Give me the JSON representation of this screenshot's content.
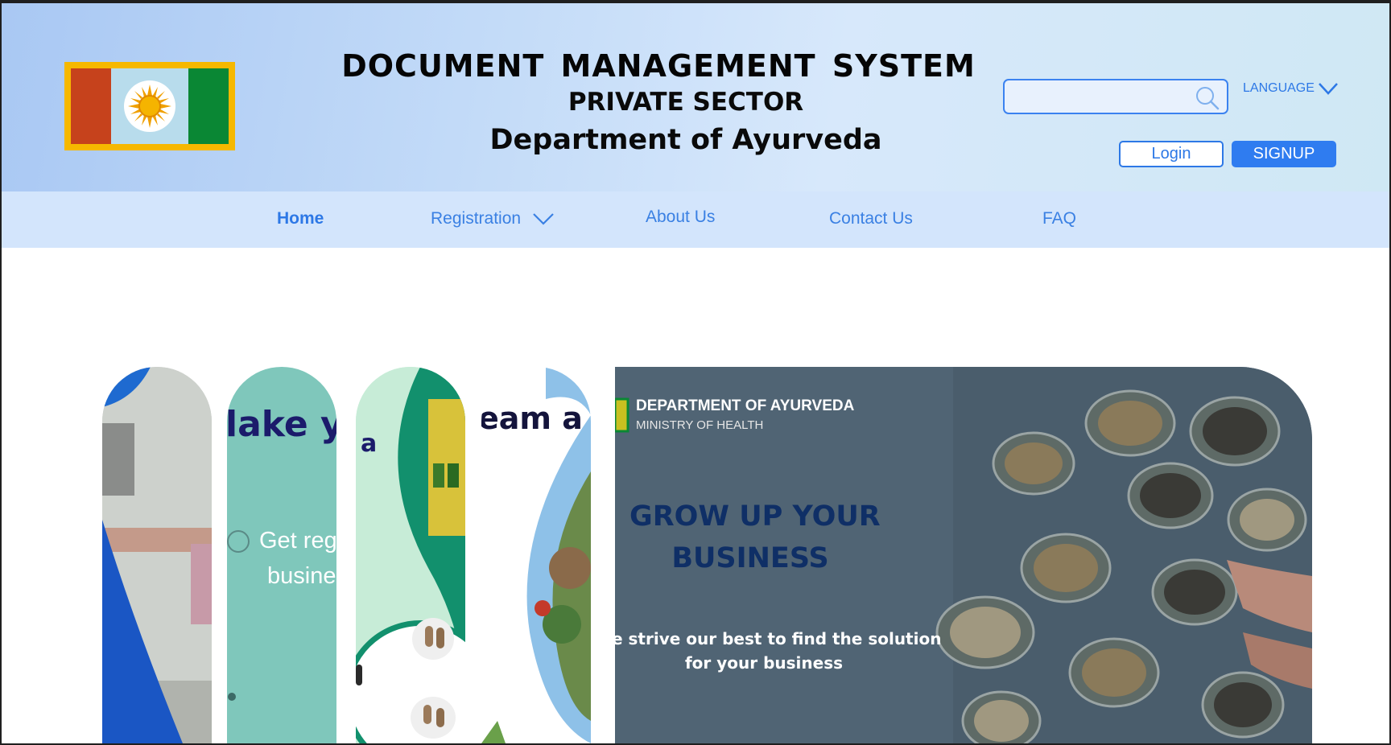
{
  "header": {
    "title": "DOCUMENT  MANAGEMENT  SYSTEM",
    "subtitle": "PRIVATE SECTOR",
    "department": "Department of Ayurveda",
    "search": {
      "placeholder": "",
      "value": ""
    },
    "language_label": "LANGUAGE",
    "login_label": "Login",
    "signup_label": "SIGNUP"
  },
  "nav": {
    "items": [
      {
        "label": "Home",
        "active": true
      },
      {
        "label": "Registration",
        "dropdown": true
      },
      {
        "label": "About Us"
      },
      {
        "label": "Contact Us"
      },
      {
        "label": "FAQ"
      }
    ]
  },
  "carousel": {
    "card2_heading": "lake yo",
    "card2_line1": "Get reg",
    "card2_line2": "busine",
    "card3_text": "a",
    "card4_heading": "eam a",
    "main": {
      "org_name": "DEPARTMENT OF AYURVEDA",
      "ministry": "MINISTRY OF HEALTH",
      "headline_line1": "GROW UP YOUR",
      "headline_line2": "BUSINESS",
      "tagline_line1": "e strive our best to find the solution",
      "tagline_line2": "for your business"
    }
  },
  "colors": {
    "accent": "#2f7cf0",
    "header_bg": "#c3dbf8",
    "nav_bg": "#d3e5fc",
    "headline": "#0f2f66"
  }
}
